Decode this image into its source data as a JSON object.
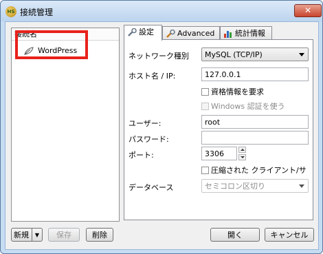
{
  "window": {
    "title": "接続管理",
    "close_glyph": "✕",
    "icon_text": "HS"
  },
  "connections": {
    "header": "接続名",
    "items": [
      {
        "name": "WordPress",
        "icon": "leaf-icon"
      }
    ]
  },
  "buttons": {
    "new": "新規",
    "new_dropdown": "▼",
    "save": "保存",
    "delete": "削除",
    "open": "開く",
    "cancel": "キャンセル"
  },
  "tabs": [
    {
      "label": "設定",
      "icon": "wrench-icon",
      "active": true
    },
    {
      "label": "Advanced",
      "icon": "wrench-icon",
      "active": false
    },
    {
      "label": "統計情報",
      "icon": "bar-chart-icon",
      "active": false
    }
  ],
  "settings": {
    "network_type_label": "ネットワーク種別",
    "network_type_value": "MySQL (TCP/IP)",
    "host_label": "ホスト名 / IP:",
    "host_value": "127.0.0.1",
    "require_credentials_label": "資格情報を要求",
    "windows_auth_label": "Windows 認証を使う",
    "user_label": "ユーザー:",
    "user_value": "root",
    "password_label": "パスワード:",
    "password_value": "",
    "port_label": "ポート:",
    "port_value": "3306",
    "compressed_label": "圧縮された クライアント/サ",
    "database_label": "データベース",
    "database_placeholder": "セミコロン区切り"
  },
  "colors": {
    "highlight": "#e8221b",
    "title_bar": "#c6dcf2",
    "close_button": "#c8452e"
  }
}
